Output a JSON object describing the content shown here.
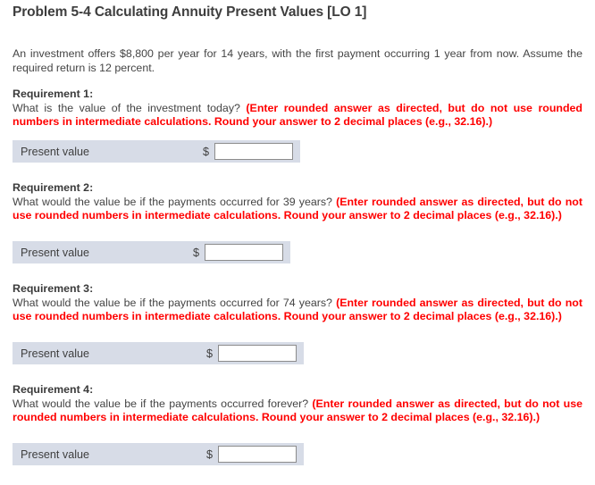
{
  "page": {
    "title": "Problem 5-4 Calculating Annuity Present Values [LO 1]",
    "intro": "An investment offers $8,800 per year for 14 years, with the first payment occurring 1 year from now. Assume the required return is 12 percent."
  },
  "colors": {
    "note_red": "#ff0000",
    "row_background": "#d7dce7",
    "input_border": "#8c8c8c",
    "text": "#444444"
  },
  "requirements": [
    {
      "heading": "Requirement 1:",
      "question": "What is the value of the investment today? ",
      "note": "(Enter rounded answer as directed, but do not use rounded numbers in intermediate calculations. Round your answer to 2 decimal places (e.g., 32.16).)",
      "answer": {
        "label": "Present value",
        "currency": "$",
        "value": "",
        "placeholder": ""
      }
    },
    {
      "heading": "Requirement 2:",
      "question": "What would the value be if the payments occurred for 39 years? ",
      "note": "(Enter rounded answer as directed, but do not use rounded numbers in intermediate calculations. Round your answer to 2 decimal places (e.g., 32.16).)",
      "answer": {
        "label": "Present value",
        "currency": "$",
        "value": "",
        "placeholder": ""
      }
    },
    {
      "heading": "Requirement 3:",
      "question": "What would the value be if the payments occurred for 74 years? ",
      "note": "(Enter rounded answer as directed, but do not use rounded numbers in intermediate calculations. Round your answer to 2 decimal places (e.g., 32.16).)",
      "answer": {
        "label": "Present value",
        "currency": "$",
        "value": "",
        "placeholder": ""
      }
    },
    {
      "heading": "Requirement 4:",
      "question": "What would the value be if the payments occurred forever? ",
      "note": "(Enter rounded answer as directed, but do not use rounded numbers in intermediate calculations. Round your answer to 2 decimal places (e.g., 32.16).)",
      "answer": {
        "label": "Present value",
        "currency": "$",
        "value": "",
        "placeholder": ""
      }
    }
  ]
}
